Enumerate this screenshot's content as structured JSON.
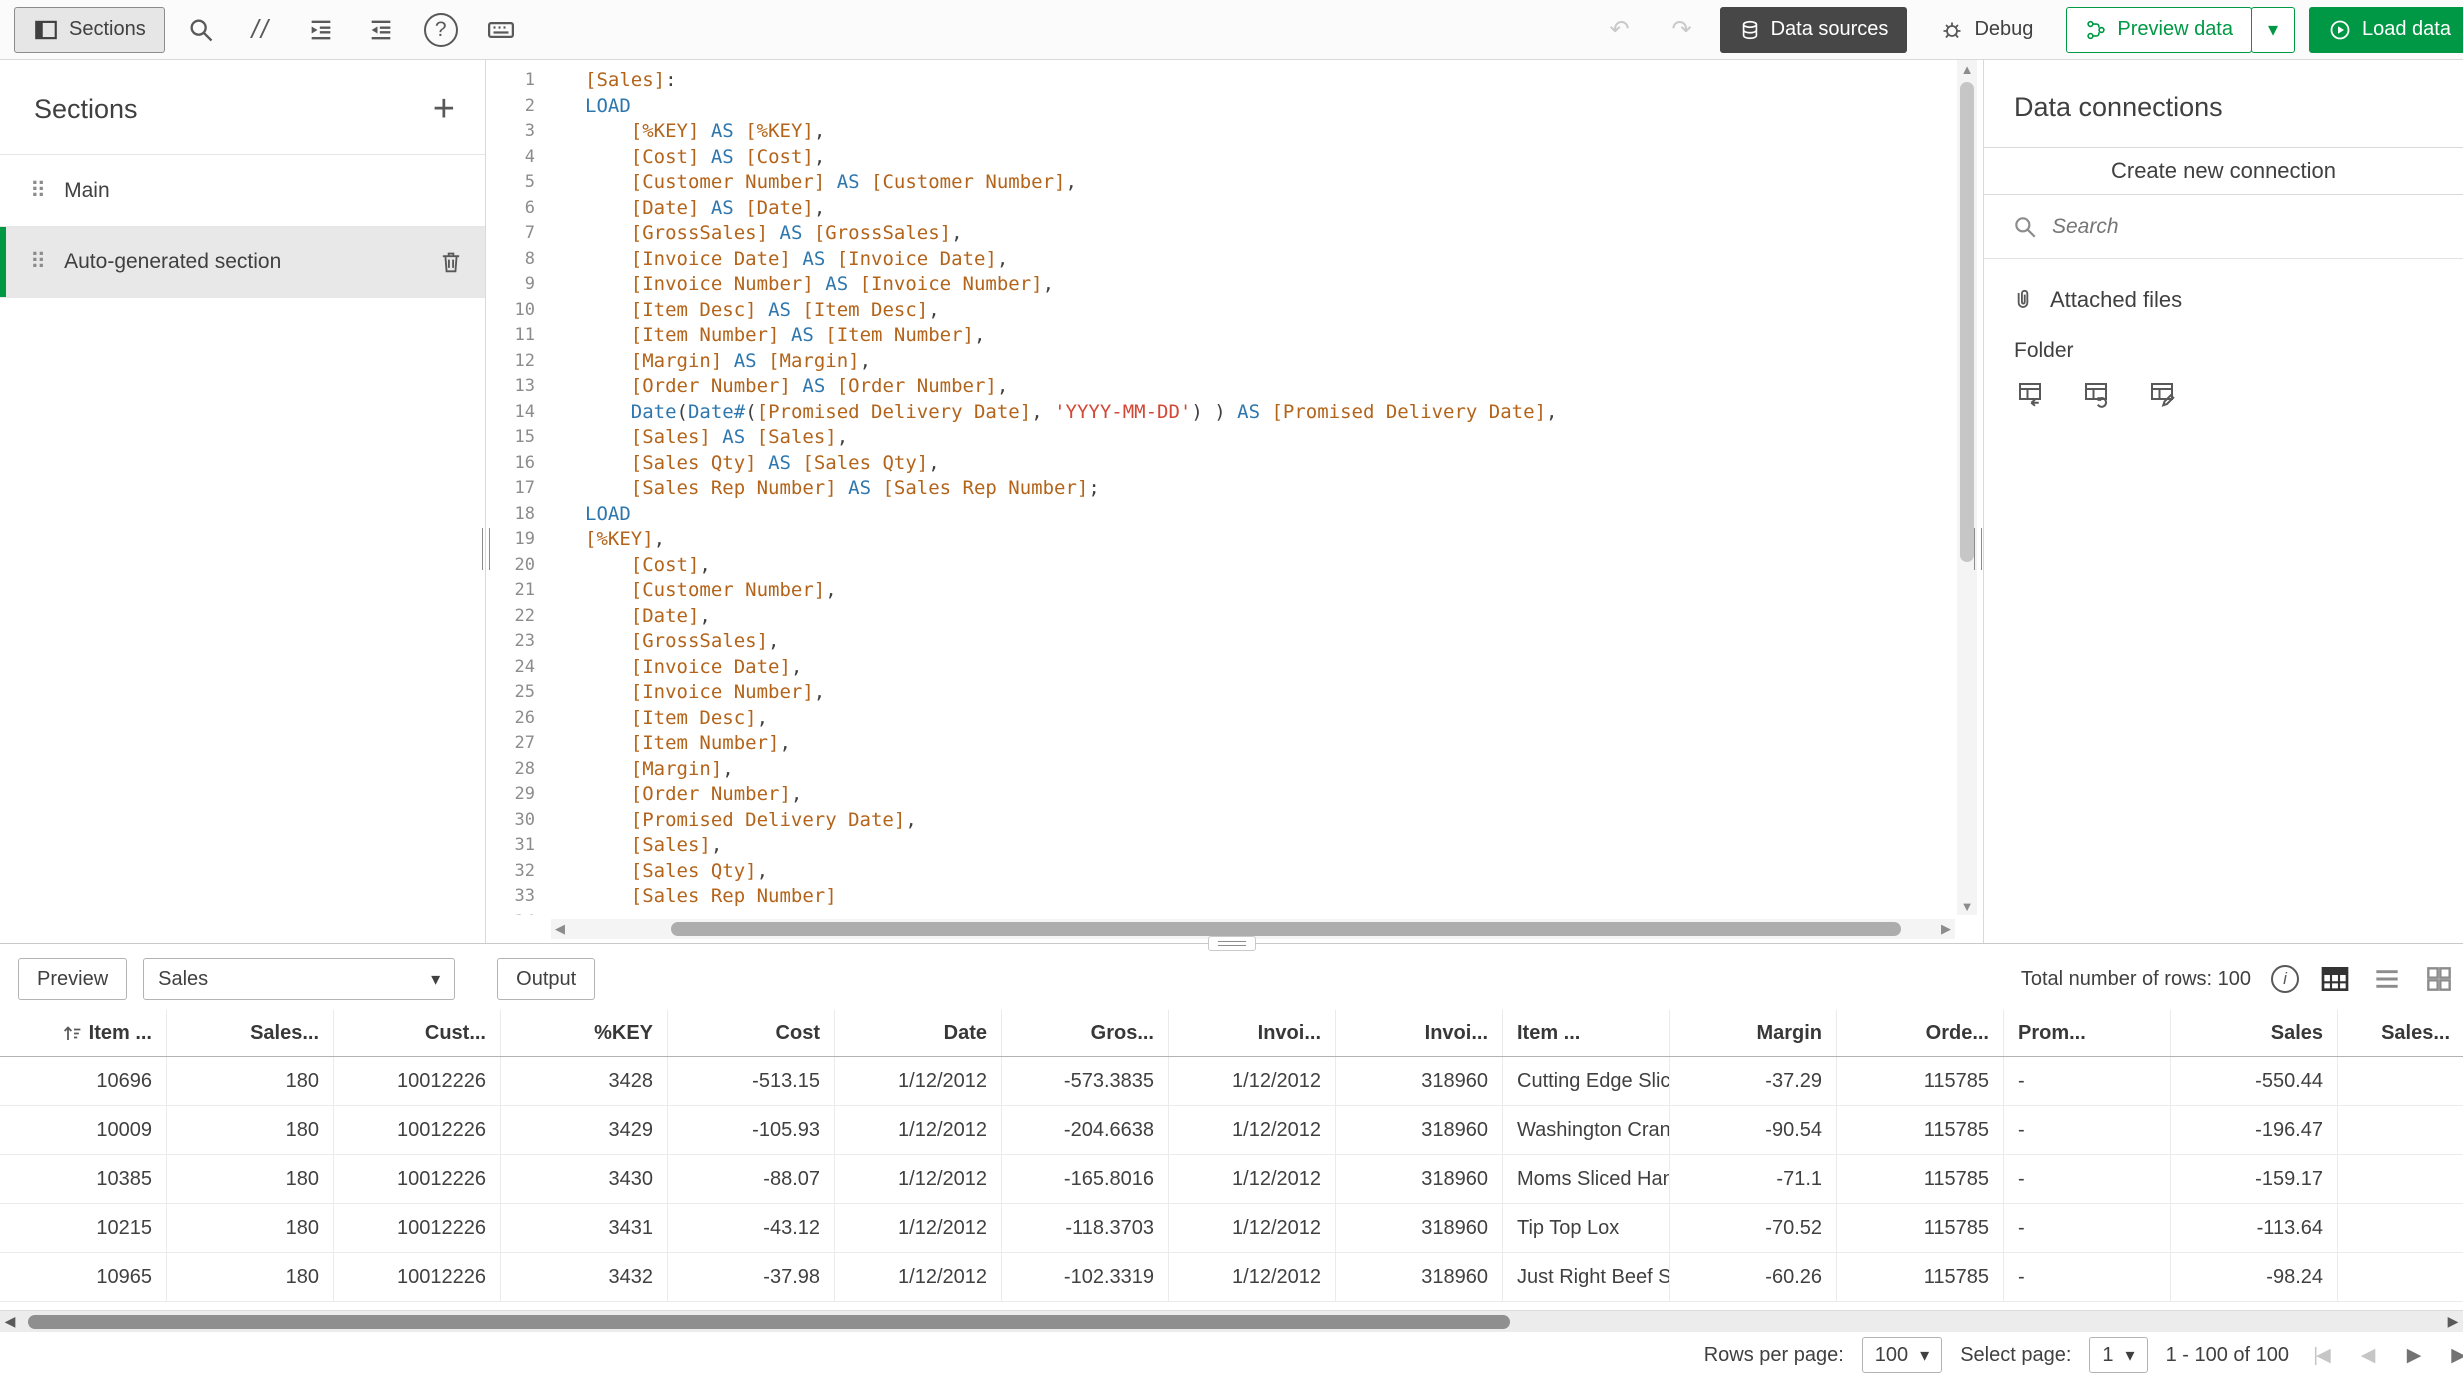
{
  "topbar": {
    "sections_label": "Sections",
    "data_sources_label": "Data sources",
    "debug_label": "Debug",
    "preview_data_label": "Preview data",
    "load_data_label": "Load data"
  },
  "sidebar": {
    "title": "Sections",
    "items": [
      {
        "label": "Main",
        "selected": false
      },
      {
        "label": "Auto-generated section",
        "selected": true
      }
    ]
  },
  "editor": {
    "lines": [
      "[Sales]:",
      "LOAD",
      "    [%KEY] AS [%KEY],",
      "    [Cost] AS [Cost],",
      "    [Customer Number] AS [Customer Number],",
      "    [Date] AS [Date],",
      "    [GrossSales] AS [GrossSales],",
      "    [Invoice Date] AS [Invoice Date],",
      "    [Invoice Number] AS [Invoice Number],",
      "    [Item Desc] AS [Item Desc],",
      "    [Item Number] AS [Item Number],",
      "    [Margin] AS [Margin],",
      "    [Order Number] AS [Order Number],",
      "    Date(Date#([Promised Delivery Date], 'YYYY-MM-DD') ) AS [Promised Delivery Date],",
      "    [Sales] AS [Sales],",
      "    [Sales Qty] AS [Sales Qty],",
      "    [Sales Rep Number] AS [Sales Rep Number];",
      "LOAD",
      "[%KEY],",
      "    [Cost],",
      "    [Customer Number],",
      "    [Date],",
      "    [GrossSales],",
      "    [Invoice Date],",
      "    [Invoice Number],",
      "    [Item Desc],",
      "    [Item Number],",
      "    [Margin],",
      "    [Order Number],",
      "    [Promised Delivery Date],",
      "    [Sales],",
      "    [Sales Qty],",
      "    [Sales Rep Number]",
      ""
    ]
  },
  "connections": {
    "title": "Data connections",
    "create_button": "Create new connection",
    "search_placeholder": "Search",
    "attached_files_label": "Attached files",
    "folder_label": "Folder"
  },
  "preview": {
    "preview_label": "Preview",
    "table_select_value": "Sales",
    "output_label": "Output",
    "total_rows_label": "Total number of rows: 100",
    "columns": [
      {
        "label": "Item ...",
        "align": "right",
        "sort": true
      },
      {
        "label": "Sales...",
        "align": "right"
      },
      {
        "label": "Cust...",
        "align": "right"
      },
      {
        "label": "%KEY",
        "align": "right"
      },
      {
        "label": "Cost",
        "align": "right"
      },
      {
        "label": "Date",
        "align": "right"
      },
      {
        "label": "Gros...",
        "align": "right"
      },
      {
        "label": "Invoi...",
        "align": "right"
      },
      {
        "label": "Invoi...",
        "align": "right"
      },
      {
        "label": "Item ...",
        "align": "left"
      },
      {
        "label": "Margin",
        "align": "right"
      },
      {
        "label": "Orde...",
        "align": "right"
      },
      {
        "label": "Prom...",
        "align": "left"
      },
      {
        "label": "Sales",
        "align": "right"
      },
      {
        "label": "Sales...",
        "align": "right"
      }
    ],
    "rows": [
      [
        "10696",
        "180",
        "10012226",
        "3428",
        "-513.15",
        "1/12/2012",
        "-573.3835",
        "1/12/2012",
        "318960",
        "Cutting Edge Slic",
        "-37.29",
        "115785",
        "-",
        "-550.44",
        ""
      ],
      [
        "10009",
        "180",
        "10012226",
        "3429",
        "-105.93",
        "1/12/2012",
        "-204.6638",
        "1/12/2012",
        "318960",
        "Washington Cran",
        "-90.54",
        "115785",
        "-",
        "-196.47",
        ""
      ],
      [
        "10385",
        "180",
        "10012226",
        "3430",
        "-88.07",
        "1/12/2012",
        "-165.8016",
        "1/12/2012",
        "318960",
        "Moms Sliced Ham",
        "-71.1",
        "115785",
        "-",
        "-159.17",
        ""
      ],
      [
        "10215",
        "180",
        "10012226",
        "3431",
        "-43.12",
        "1/12/2012",
        "-118.3703",
        "1/12/2012",
        "318960",
        "Tip Top Lox",
        "-70.52",
        "115785",
        "-",
        "-113.64",
        ""
      ],
      [
        "10965",
        "180",
        "10012226",
        "3432",
        "-37.98",
        "1/12/2012",
        "-102.3319",
        "1/12/2012",
        "318960",
        "Just Right Beef S",
        "-60.26",
        "115785",
        "-",
        "-98.24",
        ""
      ]
    ]
  },
  "pagination": {
    "rows_per_page_label": "Rows per page:",
    "rows_per_page_value": "100",
    "select_page_label": "Select page:",
    "select_page_value": "1",
    "range_label": "1 - 100 of 100"
  },
  "icons": {
    "undo": "↶",
    "redo": "↷",
    "add": "+",
    "comment_slashes": "//",
    "help": "?",
    "chevron_down": "▾",
    "grip_dots": "⠿",
    "info": "i",
    "first_page": "|◀",
    "prev_page": "◀",
    "next_page": "▶",
    "last_page": "▶|",
    "scroll_up": "▲",
    "scroll_down": "▼",
    "scroll_left": "◀",
    "scroll_right": "▶"
  },
  "colors": {
    "green": "#009845",
    "dark_button": "#474747",
    "keyword": "#2e77ae",
    "field": "#b3641a",
    "string": "#d14836"
  }
}
